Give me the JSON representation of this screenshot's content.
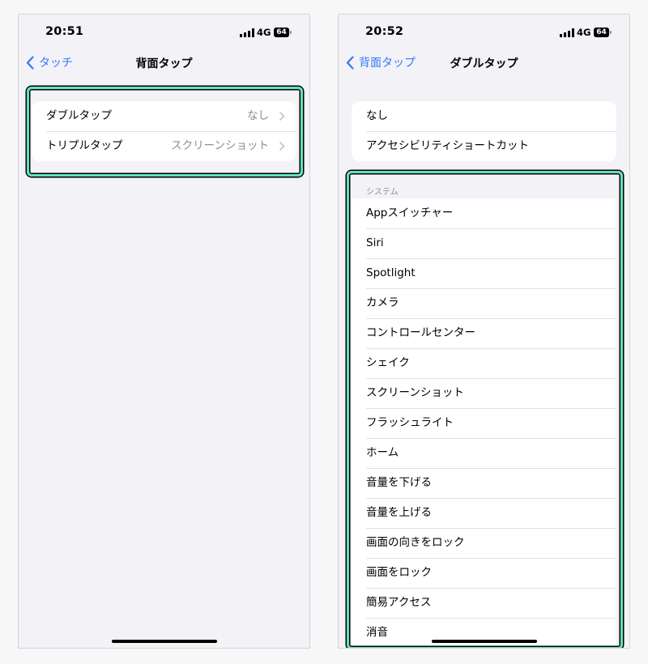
{
  "left": {
    "time": "20:51",
    "network": "4G",
    "battery": "64",
    "back_label": "タッチ",
    "title": "背面タップ",
    "rows": [
      {
        "label": "ダブルタップ",
        "value": "なし"
      },
      {
        "label": "トリプルタップ",
        "value": "スクリーンショット"
      }
    ]
  },
  "right": {
    "time": "20:52",
    "network": "4G",
    "battery": "64",
    "back_label": "背面タップ",
    "title": "ダブルタップ",
    "top_group": [
      "なし",
      "アクセシビリティショートカット"
    ],
    "section_header": "システム",
    "system_items": [
      "Appスイッチャー",
      "Siri",
      "Spotlight",
      "カメラ",
      "コントロールセンター",
      "シェイク",
      "スクリーンショット",
      "フラッシュライト",
      "ホーム",
      "音量を下げる",
      "音量を上げる",
      "画面の向きをロック",
      "画面をロック",
      "簡易アクセス",
      "消音"
    ]
  },
  "colors": {
    "accent": "#3478f6",
    "highlight": "#5fe3b5",
    "background": "#f2f2f7"
  },
  "icons": [
    "chevron-left-icon",
    "chevron-right-icon",
    "signal-icon",
    "battery-icon"
  ]
}
